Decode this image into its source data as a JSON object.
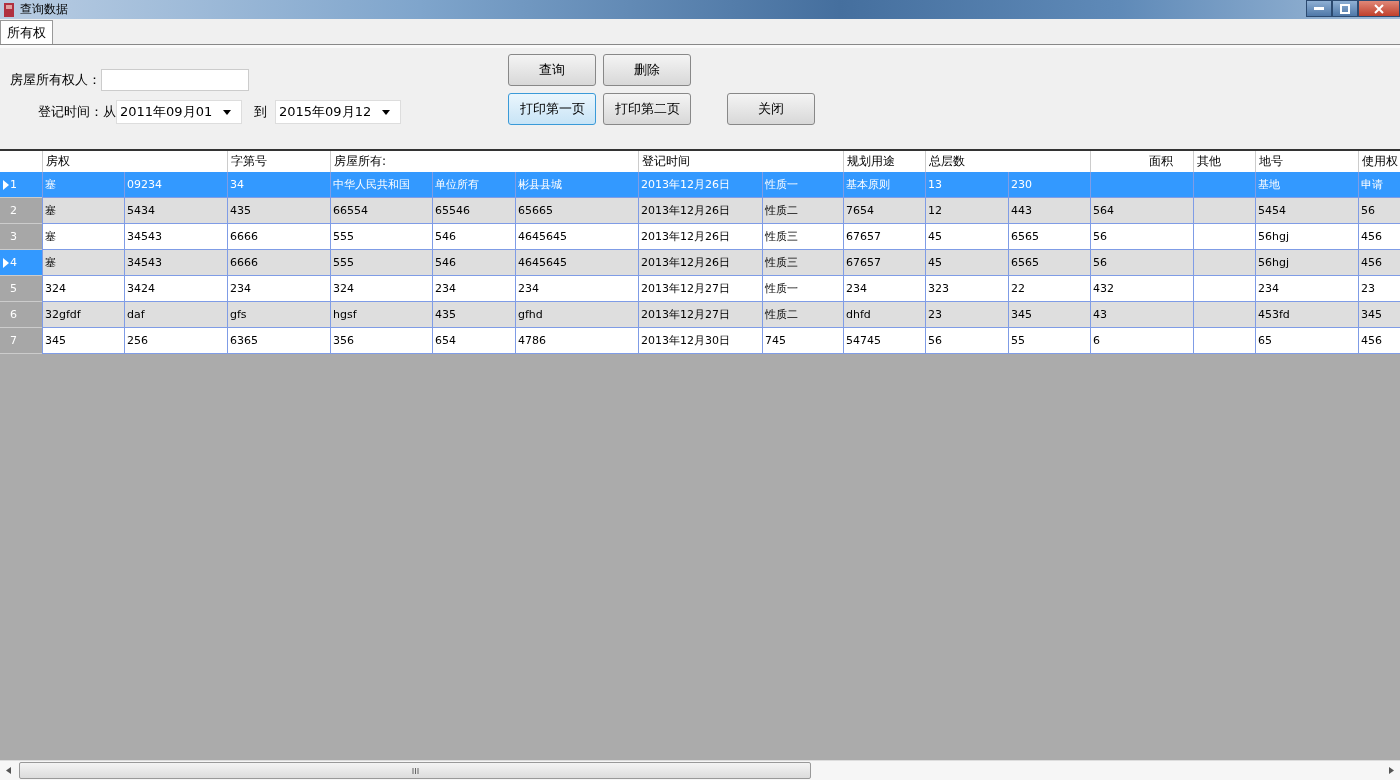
{
  "window": {
    "title": "查询数据"
  },
  "tabs": [
    {
      "label": "所有权",
      "selected": true
    }
  ],
  "form": {
    "owner_label": "房屋所有权人：",
    "date_label": "登记时间：从",
    "from_date": "2011年09月01",
    "to_label": "到",
    "to_date": "2015年09月12"
  },
  "buttons": [
    {
      "label": "查询",
      "focused": false
    },
    {
      "label": "删除",
      "focused": false
    },
    {
      "label": "打印第一页",
      "focused": true
    },
    {
      "label": "打印第二页",
      "focused": false
    },
    {
      "label": "关闭",
      "focused": false
    }
  ],
  "table": {
    "columns": [
      "房权",
      null,
      "字第号",
      "房屋所有:",
      null,
      null,
      "登记时间",
      null,
      "规划用途",
      "总层数",
      null,
      "面积",
      "其他",
      "地号",
      "使用权"
    ],
    "rows": [
      {
        "number": "1",
        "selected": true,
        "current": true,
        "cells": [
          "塞",
          "09234",
          "34",
          "中华人民共和国",
          "单位所有",
          "彬县县城",
          "2013年12月26日",
          "性质一",
          "基本原则",
          "13",
          "230",
          null,
          null,
          "基地",
          "申请"
        ]
      },
      {
        "number": "2",
        "selected": false,
        "current": false,
        "cells": [
          "塞",
          "5434",
          "435",
          "66554",
          "65546",
          "65665",
          "2013年12月26日",
          "性质二",
          "7654",
          "12",
          "443",
          "564",
          null,
          "5454",
          "56"
        ]
      },
      {
        "number": "3",
        "selected": false,
        "current": false,
        "cells": [
          "塞",
          "34543",
          "6666",
          "555",
          "546",
          "4645645",
          "2013年12月26日",
          "性质三",
          "67657",
          "45",
          "6565",
          "56",
          null,
          "56hgj",
          "456"
        ]
      },
      {
        "number": "4",
        "selected": false,
        "current": true,
        "cells": [
          "塞",
          "34543",
          "6666",
          "555",
          "546",
          "4645645",
          "2013年12月26日",
          "性质三",
          "67657",
          "45",
          "6565",
          "56",
          null,
          "56hgj",
          "456"
        ]
      },
      {
        "number": "5",
        "selected": false,
        "current": false,
        "cells": [
          "324",
          "3424",
          "234",
          "324",
          "234",
          "234",
          "2013年12月27日",
          "性质一",
          "234",
          "323",
          "22",
          "432",
          null,
          "234",
          "23"
        ]
      },
      {
        "number": "6",
        "selected": false,
        "current": false,
        "cells": [
          "32gfdf",
          "daf",
          "gfs",
          "hgsf",
          "435",
          "gfhd",
          "2013年12月27日",
          "性质二",
          "dhfd",
          "23",
          "345",
          "43",
          null,
          "453fd",
          "345"
        ]
      },
      {
        "number": "7",
        "selected": false,
        "current": false,
        "cells": [
          "345",
          "256",
          "6365",
          "356",
          "654",
          "4786",
          "2013年12月30日",
          "745",
          "54745",
          "56",
          "55",
          "6",
          null,
          "65",
          "456"
        ]
      }
    ]
  }
}
